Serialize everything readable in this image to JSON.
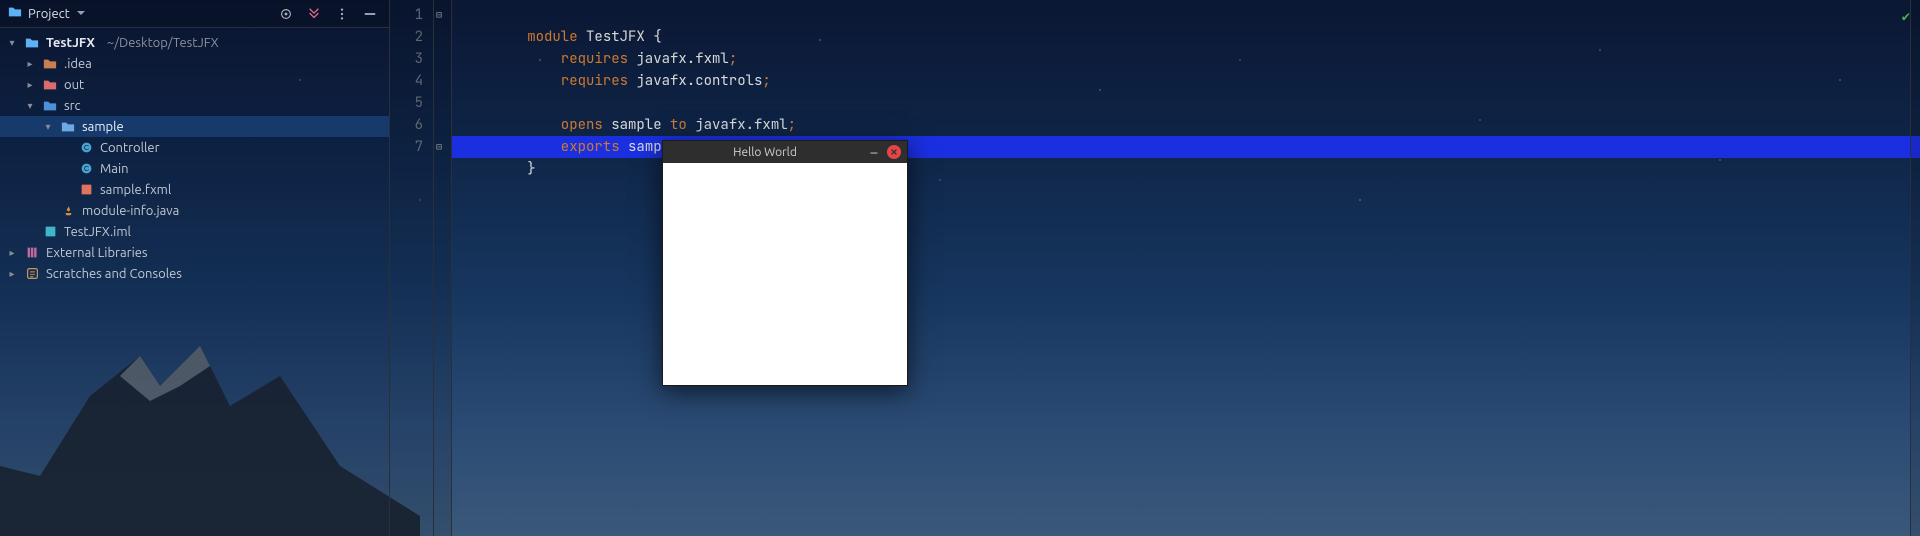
{
  "project_panel": {
    "title": "Project",
    "toolbar": {
      "target_icon": "target-icon",
      "collapse_icon": "collapse-icon",
      "menu_icon": "kebab-icon",
      "hide_icon": "hide-panel-icon"
    }
  },
  "tree": {
    "root": {
      "label": "TestJFX",
      "path": "~/Desktop/TestJFX"
    },
    "nodes": {
      "idea": ".idea",
      "out": "out",
      "src": "src",
      "sample": "sample",
      "controller": "Controller",
      "main": "Main",
      "samplefxml": "sample.fxml",
      "moduleinfo": "module-info.java",
      "iml": "TestJFX.iml",
      "extlib": "External Libraries",
      "scratches": "Scratches and Consoles"
    }
  },
  "editor": {
    "highlighted_line": 7,
    "lines": [
      "1",
      "2",
      "3",
      "4",
      "5",
      "6",
      "7"
    ],
    "code": {
      "l1a": "module ",
      "l1b": "TestJFX ",
      "l1c": "{",
      "l2a": "    requires ",
      "l2b": "javafx.fxml",
      "l2c": ";",
      "l3a": "    requires ",
      "l3b": "javafx.controls",
      "l3c": ";",
      "l4": "",
      "l5a": "    opens ",
      "l5b": "sample ",
      "l5c": "to ",
      "l5d": "javafx.fxml",
      "l5e": ";",
      "l6a": "    exports ",
      "l6b": "sample",
      "l6c": ";",
      "l7": "}"
    }
  },
  "app_window": {
    "title": "Hello World"
  }
}
